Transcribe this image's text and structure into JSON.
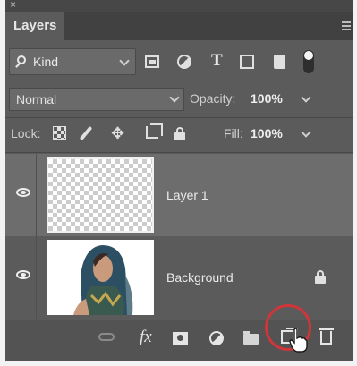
{
  "panel": {
    "tab_title": "Layers",
    "close_glyph": "×",
    "menu_icon": "panel-menu-icon"
  },
  "filter": {
    "kind_label": "Kind",
    "icons": [
      "image-filter-icon",
      "adjustment-filter-icon",
      "type-filter-icon",
      "shape-filter-icon",
      "smart-object-filter-icon",
      "filter-toggle"
    ]
  },
  "blend": {
    "mode": "Normal",
    "opacity_label": "Opacity:",
    "opacity_value": "100%"
  },
  "lock": {
    "label": "Lock:",
    "fill_label": "Fill:",
    "fill_value": "100%"
  },
  "layers": [
    {
      "name": "Layer 1",
      "selected": true,
      "visible": true,
      "thumbnail": "transparent"
    },
    {
      "name": "Background",
      "selected": false,
      "visible": true,
      "locked": true,
      "thumbnail": "photo"
    }
  ],
  "footer": {
    "fx_label": "fx",
    "icons": [
      "link-layers-icon",
      "layer-style-icon",
      "add-mask-icon",
      "adjustment-layer-icon",
      "new-group-icon",
      "new-layer-icon",
      "delete-layer-icon"
    ],
    "highlight_color": "#d0353a"
  },
  "colors": {
    "panel_bg": "#5b5b5b",
    "selected_row": "#6d6d6d",
    "tab_bar": "#414141"
  }
}
